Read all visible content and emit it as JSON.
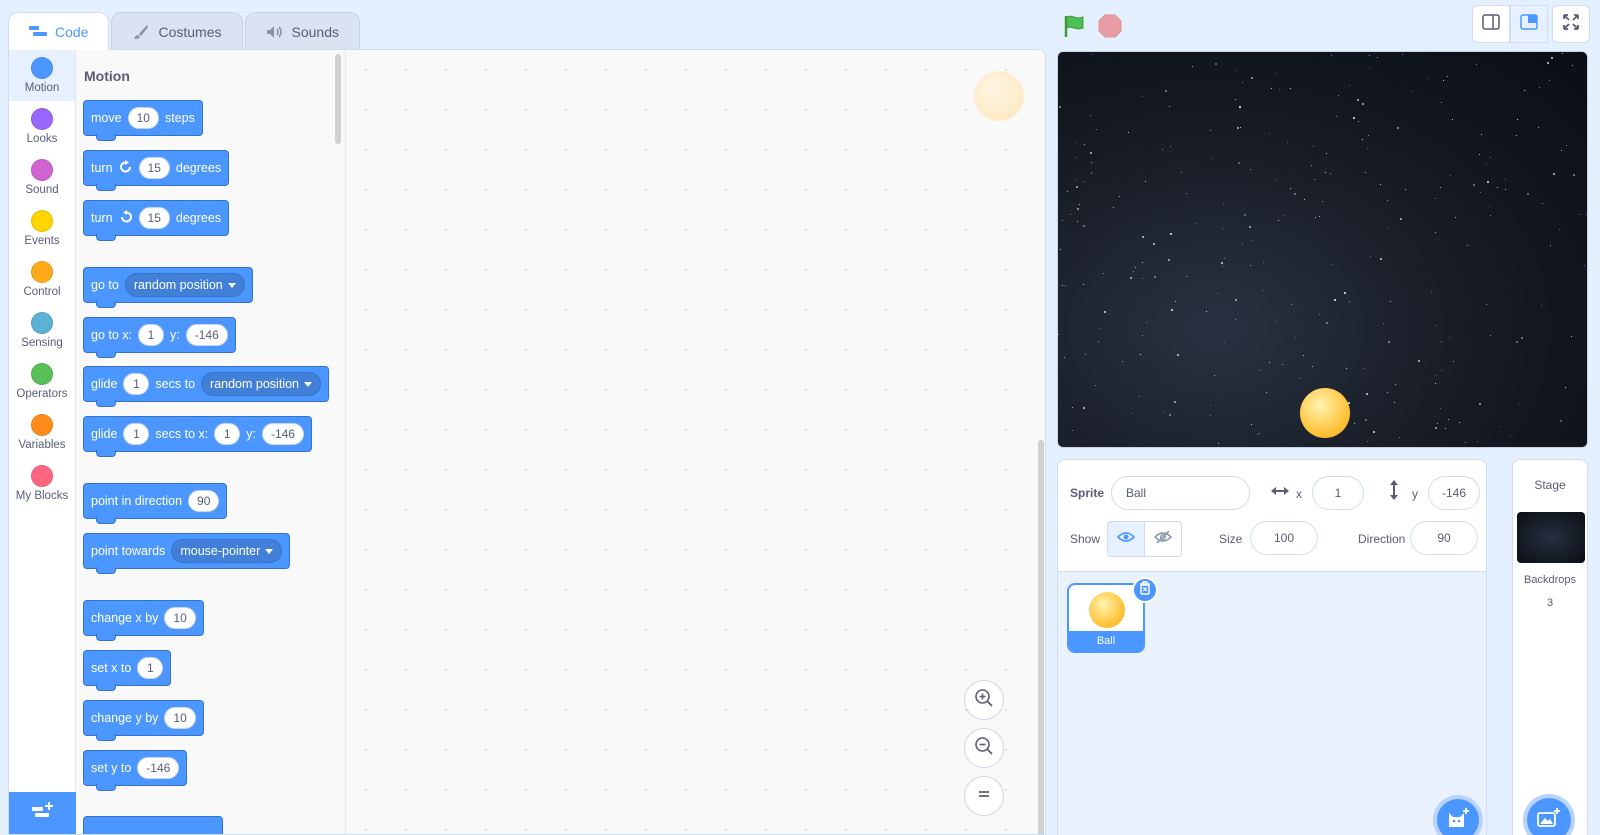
{
  "tabs": [
    {
      "label": "Code",
      "icon": "code-icon"
    },
    {
      "label": "Costumes",
      "icon": "brush-icon"
    },
    {
      "label": "Sounds",
      "icon": "speaker-icon"
    }
  ],
  "categories": [
    {
      "label": "Motion",
      "color": "#4c97ff"
    },
    {
      "label": "Looks",
      "color": "#9966ff"
    },
    {
      "label": "Sound",
      "color": "#cf63cf"
    },
    {
      "label": "Events",
      "color": "#ffd500"
    },
    {
      "label": "Control",
      "color": "#ffab19"
    },
    {
      "label": "Sensing",
      "color": "#5cb1d6"
    },
    {
      "label": "Operators",
      "color": "#59c059"
    },
    {
      "label": "Variables",
      "color": "#ff8c1a"
    },
    {
      "label": "My Blocks",
      "color": "#ff6680"
    }
  ],
  "palette": {
    "title": "Motion",
    "move": {
      "a": "move",
      "n": "10",
      "b": "steps"
    },
    "turn_right": {
      "a": "turn",
      "n": "15",
      "b": "degrees"
    },
    "turn_left": {
      "a": "turn",
      "n": "15",
      "b": "degrees"
    },
    "goto_random": {
      "a": "go to",
      "dd": "random position"
    },
    "goto_xy": {
      "a": "go to x:",
      "x": "1",
      "b": "y:",
      "y": "-146"
    },
    "glide_random": {
      "a": "glide",
      "n": "1",
      "b": "secs to",
      "dd": "random position"
    },
    "glide_xy": {
      "a": "glide",
      "n": "1",
      "b": "secs to x:",
      "x": "1",
      "c": "y:",
      "y": "-146"
    },
    "point_dir": {
      "a": "point in direction",
      "n": "90"
    },
    "point_towards": {
      "a": "point towards",
      "dd": "mouse-pointer"
    },
    "change_x": {
      "a": "change x by",
      "n": "10"
    },
    "set_x": {
      "a": "set x to",
      "n": "1"
    },
    "change_y": {
      "a": "change y by",
      "n": "10"
    },
    "set_y": {
      "a": "set y to",
      "n": "-146"
    }
  },
  "sprite_info": {
    "sprite_label": "Sprite",
    "sprite_name": "Ball",
    "x_label": "x",
    "x_value": "1",
    "y_label": "y",
    "y_value": "-146",
    "show_label": "Show",
    "size_label": "Size",
    "size_value": "100",
    "direction_label": "Direction",
    "direction_value": "90"
  },
  "sprites": [
    {
      "name": "Ball"
    }
  ],
  "stage_pane": {
    "title": "Stage",
    "backdrops_label": "Backdrops",
    "backdrops_count": "3"
  }
}
